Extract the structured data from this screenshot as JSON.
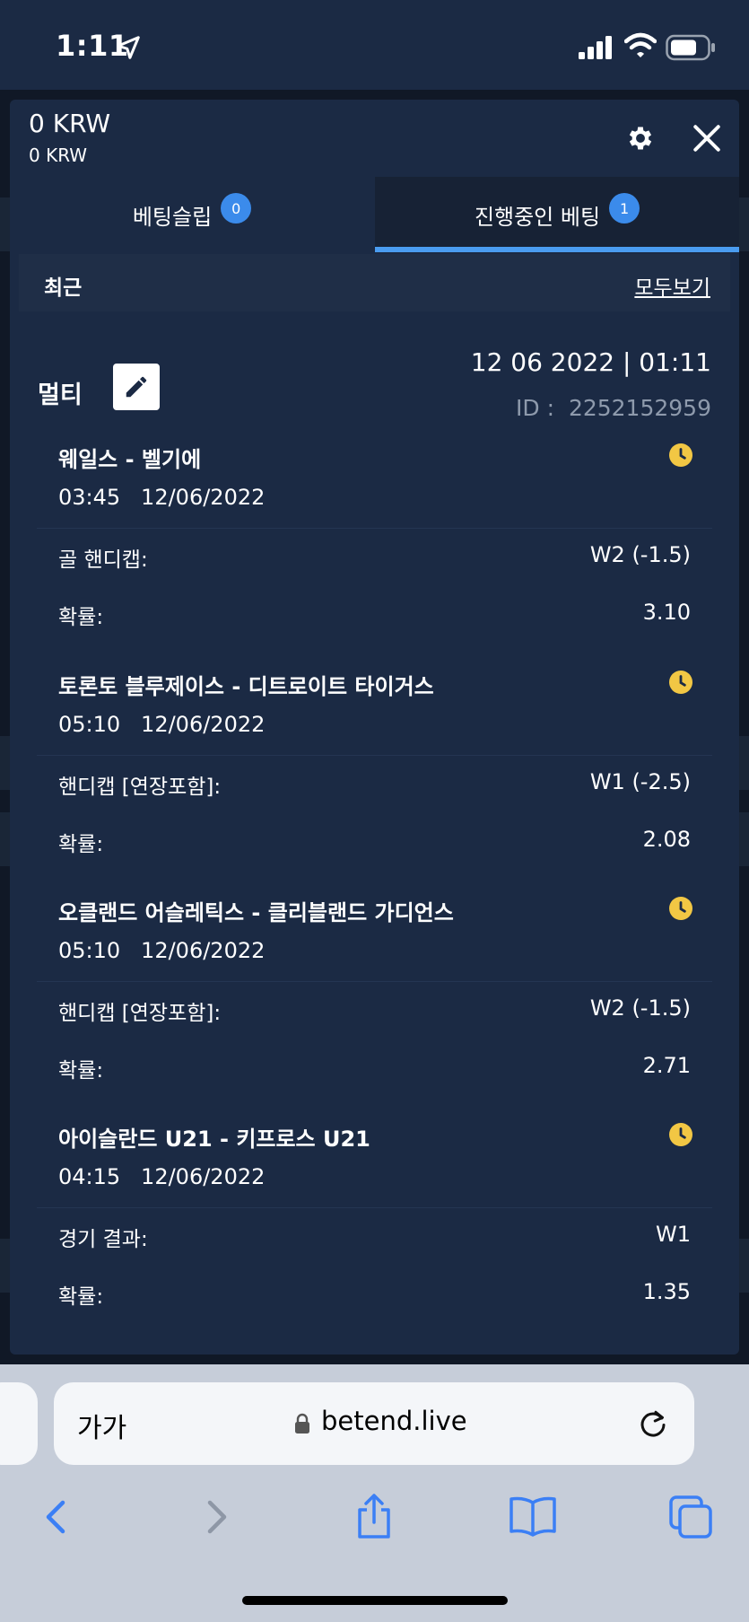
{
  "status_bar": {
    "time": "1:11"
  },
  "panel": {
    "balance_main": "0 KRW",
    "balance_sub": "0 KRW",
    "tabs": [
      {
        "label": "베팅슬립",
        "badge": "0"
      },
      {
        "label": "진행중인 베팅",
        "badge": "1"
      }
    ],
    "recent_label": "최근",
    "view_all_label": "모두보기"
  },
  "bet": {
    "type": "멀티",
    "datetime": "12 06 2022 | 01:11",
    "id_label": "ID :",
    "id_value": "2252152959",
    "events": [
      {
        "name": "웨일스 - 벨기에",
        "time": "03:45   12/06/2022",
        "market": "골 핸디캡:",
        "pick": "W2 (-1.5)",
        "odds_label": "확률:",
        "odds": "3.10"
      },
      {
        "name": "토론토 블루제이스 - 디트로이트 타이거스",
        "time": "05:10   12/06/2022",
        "market": "핸디캡 [연장포함]:",
        "pick": "W1 (-2.5)",
        "odds_label": "확률:",
        "odds": "2.08"
      },
      {
        "name": "오클랜드 어슬레틱스 - 클리블랜드 가디언스",
        "time": "05:10   12/06/2022",
        "market": "핸디캡 [연장포함]:",
        "pick": "W2 (-1.5)",
        "odds_label": "확률:",
        "odds": "2.71"
      },
      {
        "name": "아이슬란드 U21 - 키프로스 U21",
        "time": "04:15   12/06/2022",
        "market": "경기 결과:",
        "pick": "W1",
        "odds_label": "확률:",
        "odds": "1.35"
      }
    ]
  },
  "browser": {
    "aa_label": "가가",
    "url": "betend.live"
  },
  "colors": {
    "panel_bg": "#1b2a44",
    "accent_blue": "#4a9cf0",
    "badge_blue": "#3b8beb",
    "clock_yellow": "#f2c744"
  }
}
